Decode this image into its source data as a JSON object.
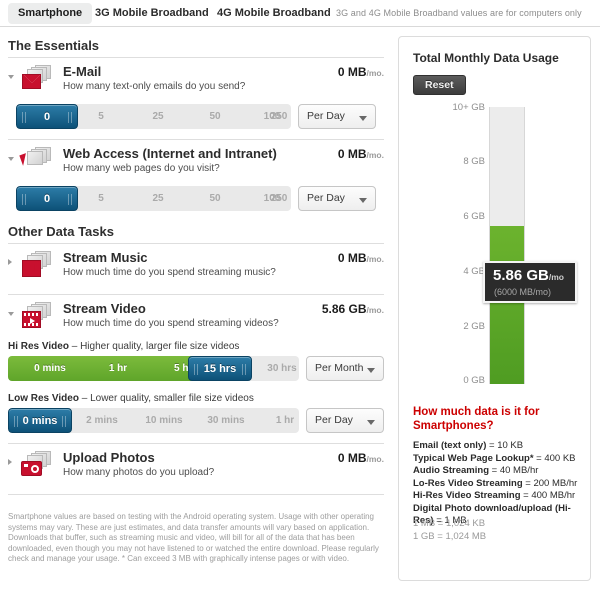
{
  "tabs": [
    {
      "label": "Smartphone",
      "active": true
    },
    {
      "label": "3G Mobile Broadband",
      "active": false
    },
    {
      "label": "4G Mobile Broadband",
      "active": false
    }
  ],
  "tab_note": "3G and 4G Mobile Broadband values are for computers only",
  "sections": [
    {
      "title": "The Essentials"
    },
    {
      "title": "Other Data Tasks"
    }
  ],
  "essentials": [
    {
      "name": "E-Mail",
      "description": "How many text-only emails do you send?",
      "value": "0 MB",
      "unit": "/mo.",
      "expanded": true,
      "icon": "email-icon",
      "slider": {
        "ticks": [
          "0",
          "5",
          "25",
          "50",
          "100",
          "250"
        ],
        "selected_index": 0,
        "selected_label": "0",
        "period": "Per Day"
      }
    },
    {
      "name": "Web Access (Internet and Intranet)",
      "description": "How many web pages do you visit?",
      "value": "0 MB",
      "unit": "/mo.",
      "expanded": true,
      "icon": "cursor-icon",
      "slider": {
        "ticks": [
          "0",
          "5",
          "25",
          "50",
          "100",
          "250"
        ],
        "selected_index": 0,
        "selected_label": "0",
        "period": "Per Day"
      }
    }
  ],
  "other_tasks": [
    {
      "name": "Stream Music",
      "description": "How much time do you spend streaming music?",
      "value": "0 MB",
      "unit": "/mo.",
      "expanded": false,
      "icon": "music-note-icon"
    },
    {
      "name": "Stream Video",
      "description": "How much time do you spend streaming videos?",
      "value": "5.86 GB",
      "unit": "/mo.",
      "expanded": true,
      "icon": "film-strip-icon",
      "sub_sliders": [
        {
          "label_strong": "Hi Res Video",
          "label_rest": " – Higher quality, larger file size videos",
          "ticks": [
            "0 mins",
            "1 hr",
            "5 hrs",
            "15 hrs",
            "30 hrs"
          ],
          "selected_index": 3,
          "selected_label": "15 hrs",
          "period": "Per Month",
          "filled": true
        },
        {
          "label_strong": "Low Res Video",
          "label_rest": " – Lower quality, smaller file size videos",
          "ticks": [
            "0 mins",
            "2 mins",
            "10 mins",
            "30 mins",
            "1 hr"
          ],
          "selected_index": 0,
          "selected_label": "0 mins",
          "period": "Per Day",
          "filled": false
        }
      ]
    },
    {
      "name": "Upload Photos",
      "description": "How many photos do you upload?",
      "value": "0 MB",
      "unit": "/mo.",
      "expanded": false,
      "icon": "camera-icon"
    }
  ],
  "footnote": "Smartphone values are based on testing with the Android operating system. Usage with other operating systems may vary.\nThese are just estimates, and data transfer amounts will vary based on application. Downloads that buffer, such as streaming music and video, will bill for all of the data that has been downloaded, even though you may not have listened to or watched the entire download. Please regularly check and manage your usage.\n* Can exceed 3 MB with graphically intense pages or with video.",
  "panel": {
    "title": "Total Monthly Data Usage",
    "reset_label": "Reset",
    "tooltip_main": "5.86 GB",
    "tooltip_unit": "/mo",
    "tooltip_sub": "(6000 MB/mo)",
    "info_title": "How much data is it for Smartphones?",
    "info_lines": [
      {
        "bold": "Email (text only)",
        "rest": " = 10 KB"
      },
      {
        "bold": "Typical Web Page Lookup*",
        "rest": " = 400 KB"
      },
      {
        "bold": "Audio Streaming",
        "rest": " = 40 MB/hr"
      },
      {
        "bold": "Lo-Res Video Streaming",
        "rest": " = 200 MB/hr"
      },
      {
        "bold": "Hi-Res Video Streaming",
        "rest": " = 400 MB/hr"
      },
      {
        "bold": "Digital Photo download/upload (Hi-Res)",
        "rest": " = 1 MB"
      }
    ],
    "conversions": [
      "1 MB = 1,024 KB",
      "1 GB = 1,024 MB"
    ]
  },
  "chart_data": {
    "type": "bar",
    "title": "Total Monthly Data Usage",
    "categories": [
      "Total Monthly Data Usage"
    ],
    "values": [
      5.86
    ],
    "value_label": "5.86 GB/mo",
    "value_mb": 6000,
    "ylabel": "",
    "xlabel": "",
    "ylim": [
      0,
      10
    ],
    "ticks": [
      {
        "label": "10+ GB",
        "value": 10
      },
      {
        "label": "8 GB",
        "value": 8
      },
      {
        "label": "6 GB",
        "value": 6
      },
      {
        "label": "4 GB",
        "value": 4
      },
      {
        "label": "2 GB",
        "value": 2
      },
      {
        "label": "0 GB",
        "value": 0
      }
    ],
    "bar_color": "#5ca527",
    "track_color": "#ececec",
    "grid": false,
    "legend": "none"
  },
  "colors": {
    "accent_red": "#c8102e",
    "accent_green": "#5ca527",
    "accent_blue": "#0d5178",
    "panel_border": "#dcdcdc"
  }
}
